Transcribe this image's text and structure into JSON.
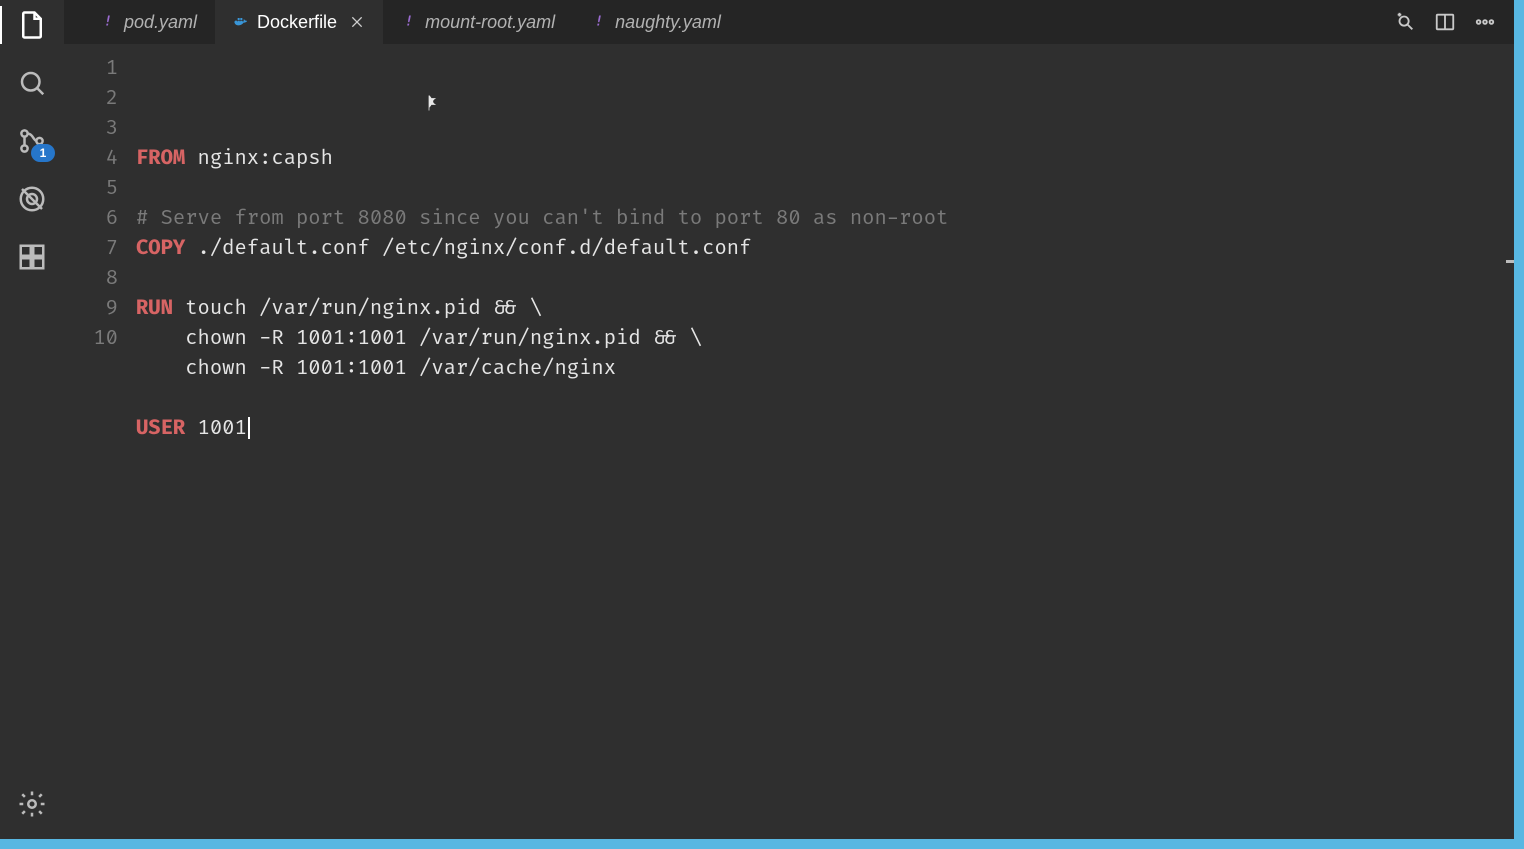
{
  "activityBar": {
    "scmBadge": "1"
  },
  "tabs": [
    {
      "label": "pod.yaml",
      "kind": "yaml",
      "active": false,
      "closeable": false
    },
    {
      "label": "Dockerfile",
      "kind": "docker",
      "active": true,
      "closeable": true
    },
    {
      "label": "mount-root.yaml",
      "kind": "yaml",
      "active": false,
      "closeable": false
    },
    {
      "label": "naughty.yaml",
      "kind": "yaml",
      "active": false,
      "closeable": false
    }
  ],
  "editor": {
    "lineNumbers": [
      "1",
      "2",
      "3",
      "4",
      "5",
      "6",
      "7",
      "8",
      "9",
      "10"
    ],
    "lines": [
      [
        {
          "cls": "tok-keyword",
          "t": "FROM"
        },
        {
          "cls": "tok-text",
          "t": " nginx:capsh"
        }
      ],
      [
        {
          "cls": "tok-text",
          "t": ""
        }
      ],
      [
        {
          "cls": "tok-comment",
          "t": "# Serve from port 8080 since you can't bind to port 80 as non-root"
        }
      ],
      [
        {
          "cls": "tok-keyword",
          "t": "COPY"
        },
        {
          "cls": "tok-text",
          "t": " ./default.conf /etc/nginx/conf.d/default.conf"
        }
      ],
      [
        {
          "cls": "tok-text",
          "t": ""
        }
      ],
      [
        {
          "cls": "tok-keyword",
          "t": "RUN"
        },
        {
          "cls": "tok-text",
          "t": " touch /var/run/nginx.pid && \\"
        }
      ],
      [
        {
          "cls": "tok-text",
          "t": "    chown -R 1001:1001 /var/run/nginx.pid && \\"
        }
      ],
      [
        {
          "cls": "tok-text",
          "t": "    chown -R 1001:1001 /var/cache/nginx"
        }
      ],
      [
        {
          "cls": "tok-text",
          "t": ""
        }
      ],
      [
        {
          "cls": "tok-keyword",
          "t": "USER"
        },
        {
          "cls": "tok-text",
          "t": " 1001"
        }
      ]
    ],
    "caretLineIndex": 9
  }
}
